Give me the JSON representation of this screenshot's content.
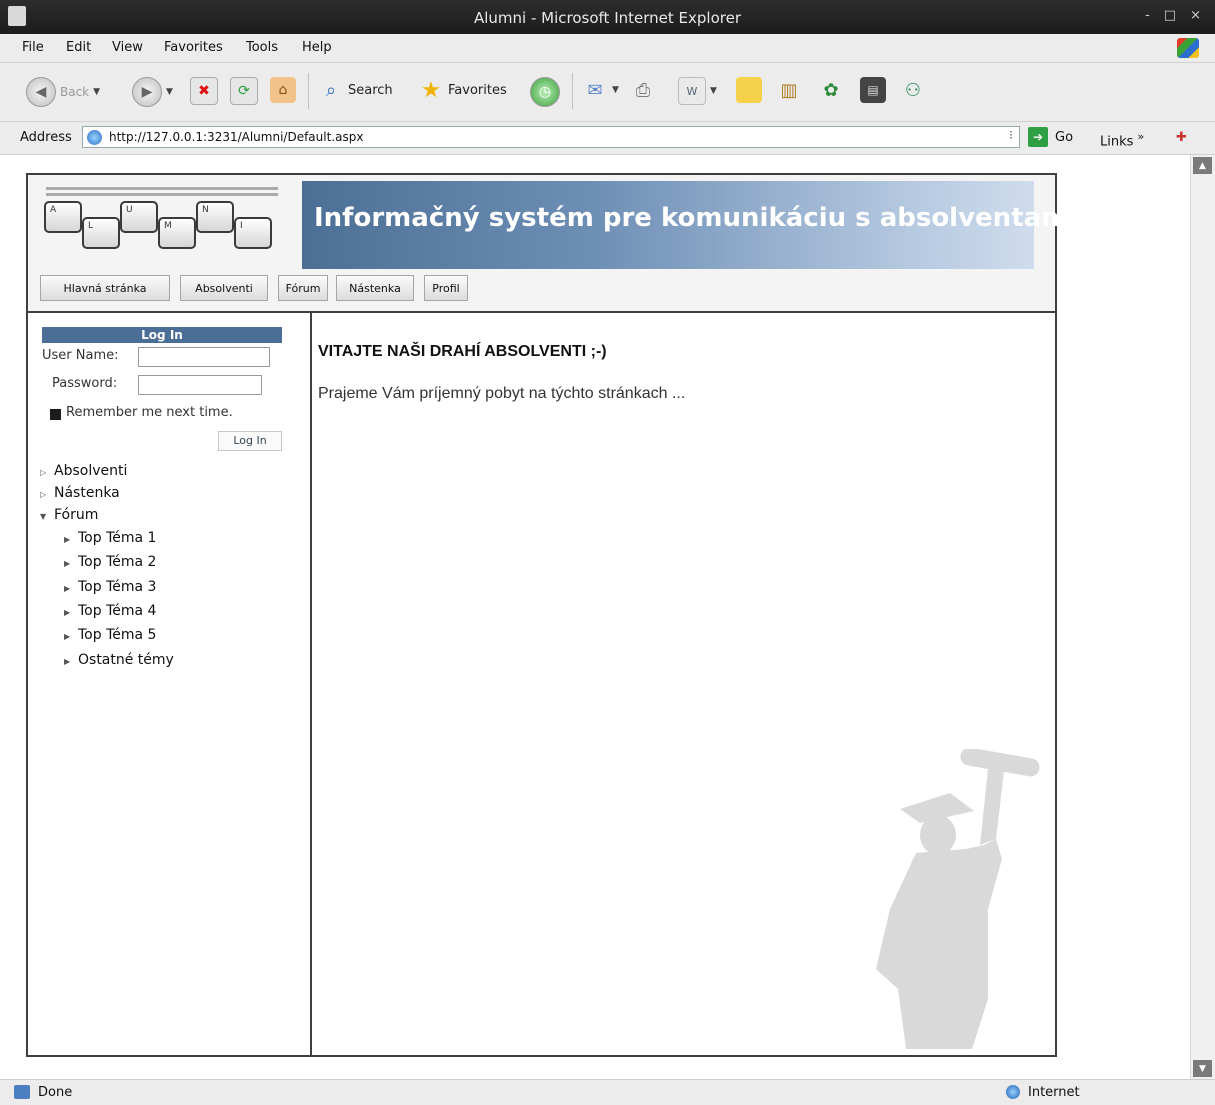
{
  "window": {
    "title": "Alumni - Microsoft Internet Explorer",
    "controls": [
      "-",
      "□",
      "×"
    ]
  },
  "menu": [
    "File",
    "Edit",
    "View",
    "Favorites",
    "Tools",
    "Help"
  ],
  "toolbar": {
    "back": "Back",
    "search": "Search",
    "favorites": "Favorites"
  },
  "address": {
    "label": "Address",
    "url": "http://127.0.0.1:3231/Alumni/Default.aspx",
    "go": "Go",
    "links": "Links",
    "links_more": "»"
  },
  "site": {
    "logo_keys": [
      "A",
      "L",
      "U",
      "M",
      "N",
      "I"
    ],
    "banner": "Informačný systém pre komunikáciu s absolventami",
    "nav": [
      "Hlavná stránka",
      "Absolventi",
      "Fórum",
      "Nástenka",
      "Profil"
    ]
  },
  "login": {
    "header": "Log In",
    "user_label": "User Name:",
    "password_label": "Password:",
    "remember": "Remember me next time.",
    "button": "Log In"
  },
  "tree": {
    "absolventi": "Absolventi",
    "nastenka": "Nástenka",
    "forum": "Fórum",
    "topics": [
      "Top Téma 1",
      "Top Téma 2",
      "Top Téma 3",
      "Top Téma 4",
      "Top Téma 5",
      "Ostatné témy"
    ]
  },
  "content": {
    "heading": "VITAJTE NAŠI DRAHÍ ABSOLVENTI ;-)",
    "text": "Prajeme Vám príjemný pobyt na týchto stránkach ..."
  },
  "status": {
    "left": "Done",
    "zone": "Internet"
  },
  "colors": {
    "banner_start": "#4c6f96",
    "banner_end": "#cfdcec",
    "login_header": "#4a6e96",
    "graduate_silhouette": "#d9d9d9"
  }
}
